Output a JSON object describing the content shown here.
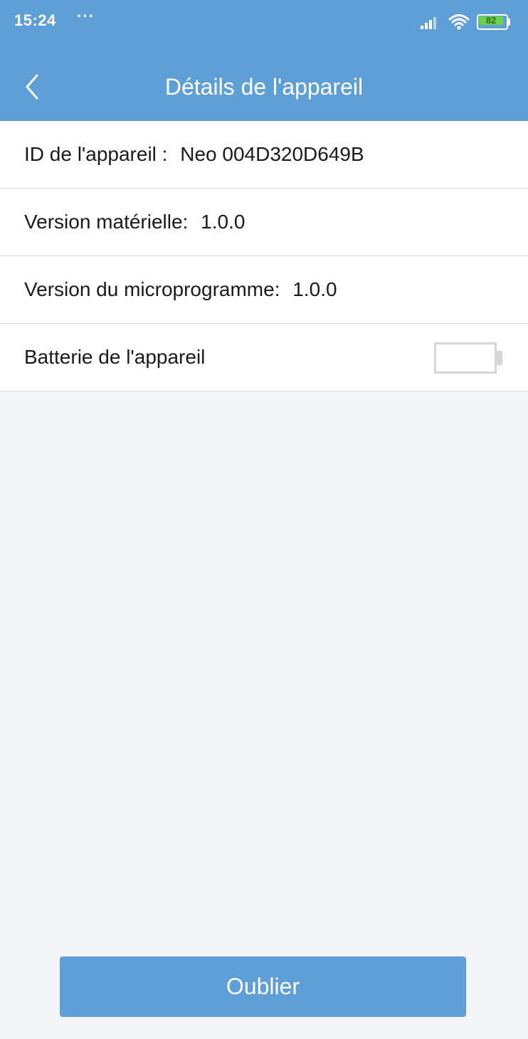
{
  "status_bar": {
    "time": "15:24",
    "dots": "···",
    "battery_level": "82",
    "battery_color": "#6dd14a",
    "icons": [
      "signal-icon",
      "wifi-icon",
      "battery-icon"
    ]
  },
  "header": {
    "title": "Détails de l'appareil",
    "back_icon": "chevron-left-icon",
    "background_color": "#5f9fd8"
  },
  "details": {
    "device_id": {
      "label": "ID de l'appareil :",
      "value": "Neo 004D320D649B"
    },
    "hardware_version": {
      "label": "Version matérielle:",
      "value": "1.0.0"
    },
    "firmware_version": {
      "label": "Version du microprogramme:",
      "value": "1.0.0"
    },
    "battery": {
      "label": "Batterie de l'appareil",
      "icon": "battery-empty-icon",
      "level_fraction": 0
    }
  },
  "actions": {
    "forget_label": "Oublier"
  }
}
